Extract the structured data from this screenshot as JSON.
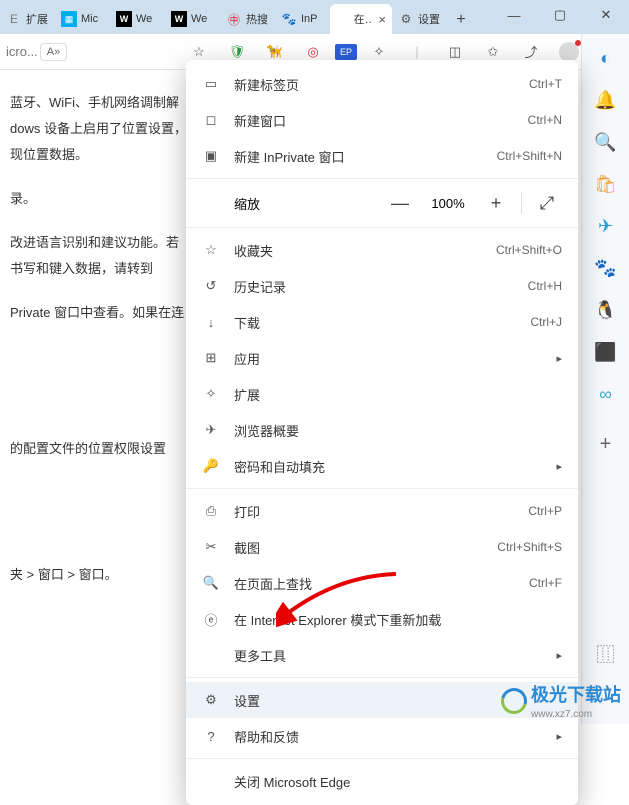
{
  "tabs": [
    {
      "fav": "E",
      "favcolor": "#777",
      "label": "扩展"
    },
    {
      "fav": "▦",
      "favcolor": "#0aa",
      "label": "Mic"
    },
    {
      "fav": "W",
      "favcolor": "#000",
      "label": "We"
    },
    {
      "fav": "W",
      "favcolor": "#000",
      "label": "We"
    },
    {
      "fav": "㊥",
      "favcolor": "#e6162d",
      "label": "热搜"
    },
    {
      "fav": "🐾",
      "favcolor": "#3b5bdb",
      "label": "InP"
    },
    {
      "fav": "",
      "favcolor": "",
      "label": "在 N",
      "active": true
    },
    {
      "fav": "⚙",
      "favcolor": "#555",
      "label": "设置"
    }
  ],
  "addr": {
    "text": "icro...",
    "aa": "A»"
  },
  "toolbar_icons": [
    {
      "name": "star-icon",
      "glyph": "☆"
    },
    {
      "name": "shield-icon",
      "glyph": "🛡",
      "color": "#2e9e44"
    },
    {
      "name": "dog-icon",
      "glyph": "🦊",
      "color": "#e8a33d"
    },
    {
      "name": "target-icon",
      "glyph": "◎",
      "color": "#d9363e"
    },
    {
      "name": "ep-icon",
      "glyph": "EP",
      "color": "#2b5fd9"
    },
    {
      "name": "puzzle-icon",
      "glyph": "✧"
    },
    {
      "name": "vline",
      "glyph": "|",
      "color": "#ccc"
    },
    {
      "name": "book-icon",
      "glyph": "▯▯"
    },
    {
      "name": "favorites-toolbar-icon",
      "glyph": "✩"
    },
    {
      "name": "share-icon",
      "glyph": "↗"
    },
    {
      "name": "profile-icon",
      "glyph": "👤"
    },
    {
      "name": "more-icon",
      "glyph": "⋯"
    }
  ],
  "page_text": {
    "p1": "蓝牙、WiFi、手机网络调制解",
    "p2": "dows 设备上启用了位置设置，",
    "p3": "现位置数据。",
    "p4": "录。",
    "p5": "改进语言识别和建议功能。若",
    "p6": "书写和键入数据，请转到",
    "p7": "Private 窗口中查看。如果在连",
    "p8": "的配置文件的位置权限设置",
    "p9": "夹 > 窗口 > 窗口。"
  },
  "menu": {
    "new_tab": "新建标签页",
    "new_tab_sc": "Ctrl+T",
    "new_win": "新建窗口",
    "new_win_sc": "Ctrl+N",
    "new_inprivate": "新建 InPrivate 窗口",
    "new_inprivate_sc": "Ctrl+Shift+N",
    "zoom": "缩放",
    "zoom_val": "100%",
    "fav": "收藏夹",
    "fav_sc": "Ctrl+Shift+O",
    "history": "历史记录",
    "history_sc": "Ctrl+H",
    "downloads": "下载",
    "downloads_sc": "Ctrl+J",
    "apps": "应用",
    "ext": "扩展",
    "performance": "浏览器概要",
    "passwords": "密码和自动填充",
    "print": "打印",
    "print_sc": "Ctrl+P",
    "screenshot": "截图",
    "screenshot_sc": "Ctrl+Shift+S",
    "find": "在页面上查找",
    "find_sc": "Ctrl+F",
    "ie": "在 Internet Explorer 模式下重新加载",
    "more_tools": "更多工具",
    "settings": "设置",
    "help": "帮助和反馈",
    "close": "关闭 Microsoft Edge"
  },
  "watermark": {
    "t1": "极光下载站",
    "t2": "www.xz7.com"
  }
}
